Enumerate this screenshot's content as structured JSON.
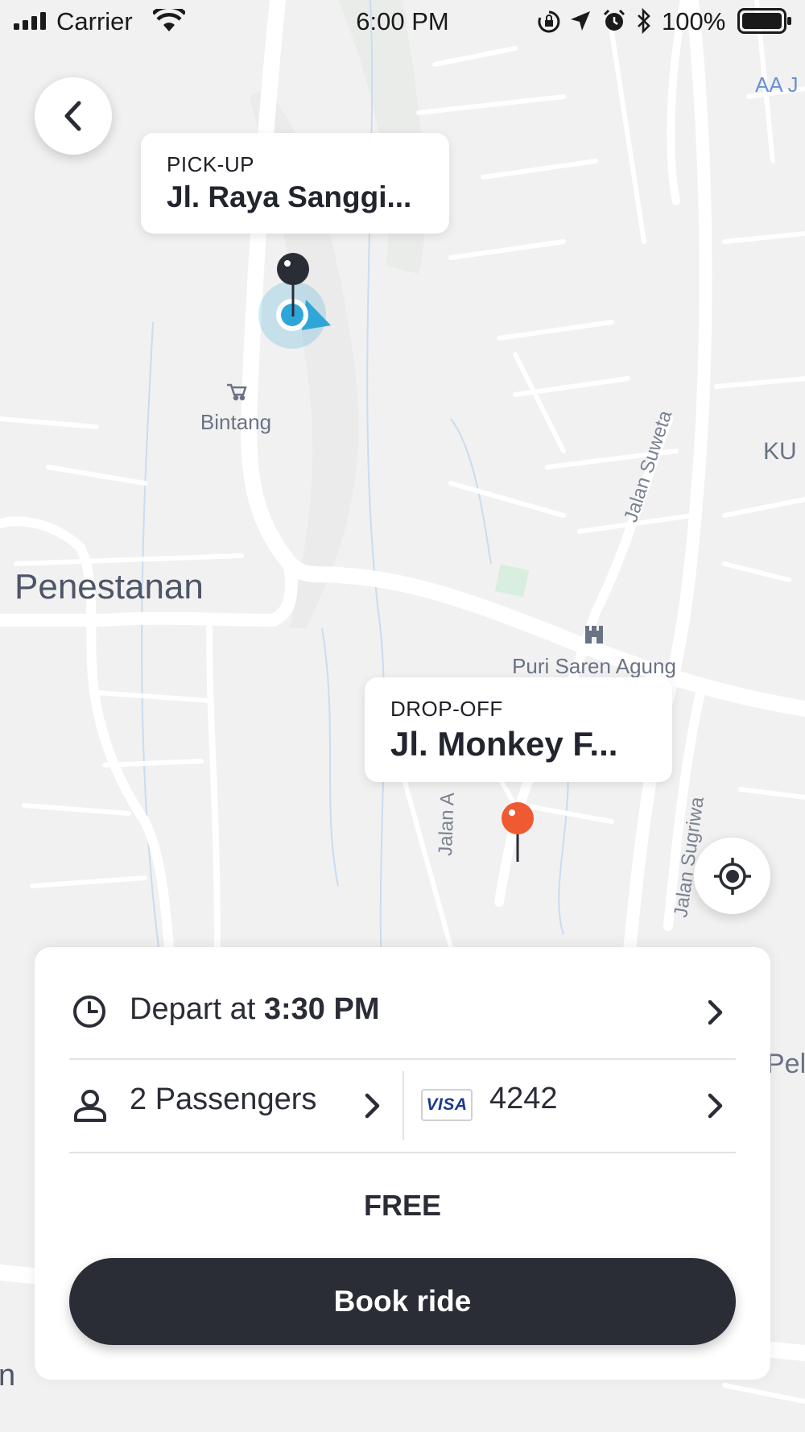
{
  "status_bar": {
    "carrier": "Carrier",
    "time": "6:00 PM",
    "battery": "100%"
  },
  "map": {
    "labels": {
      "bintang": "Bintang",
      "penestanan": "Penestanan",
      "puri": "Puri Saren Agung",
      "jalan_suweta": "Jalan Suweta",
      "jalan_sugriwa": "Jalan Sugriwa",
      "jalan_a": "Jalan A",
      "aa": "AA J",
      "ku": "KU",
      "pel": "Pel",
      "n": "n"
    }
  },
  "pickup": {
    "caption": "PICK-UP",
    "address": "Jl. Raya Sanggi..."
  },
  "dropoff": {
    "caption": "DROP-OFF",
    "address": "Jl. Monkey F..."
  },
  "booking": {
    "depart_prefix": "Depart at ",
    "depart_time": "3:30 PM",
    "passengers": "2 Passengers",
    "card_brand": "VISA",
    "card_last4": "4242",
    "price": "FREE",
    "book_label": "Book ride"
  },
  "colors": {
    "dark": "#2b2d36",
    "location_blue": "#2fa6d8",
    "dropoff_pin": "#f05a32",
    "map_bg": "#f1f1f1"
  },
  "icons": {
    "back": "chevron-left-icon",
    "locate": "crosshair-icon",
    "clock": "clock-icon",
    "person": "person-icon",
    "chevron": "chevron-right-icon"
  }
}
